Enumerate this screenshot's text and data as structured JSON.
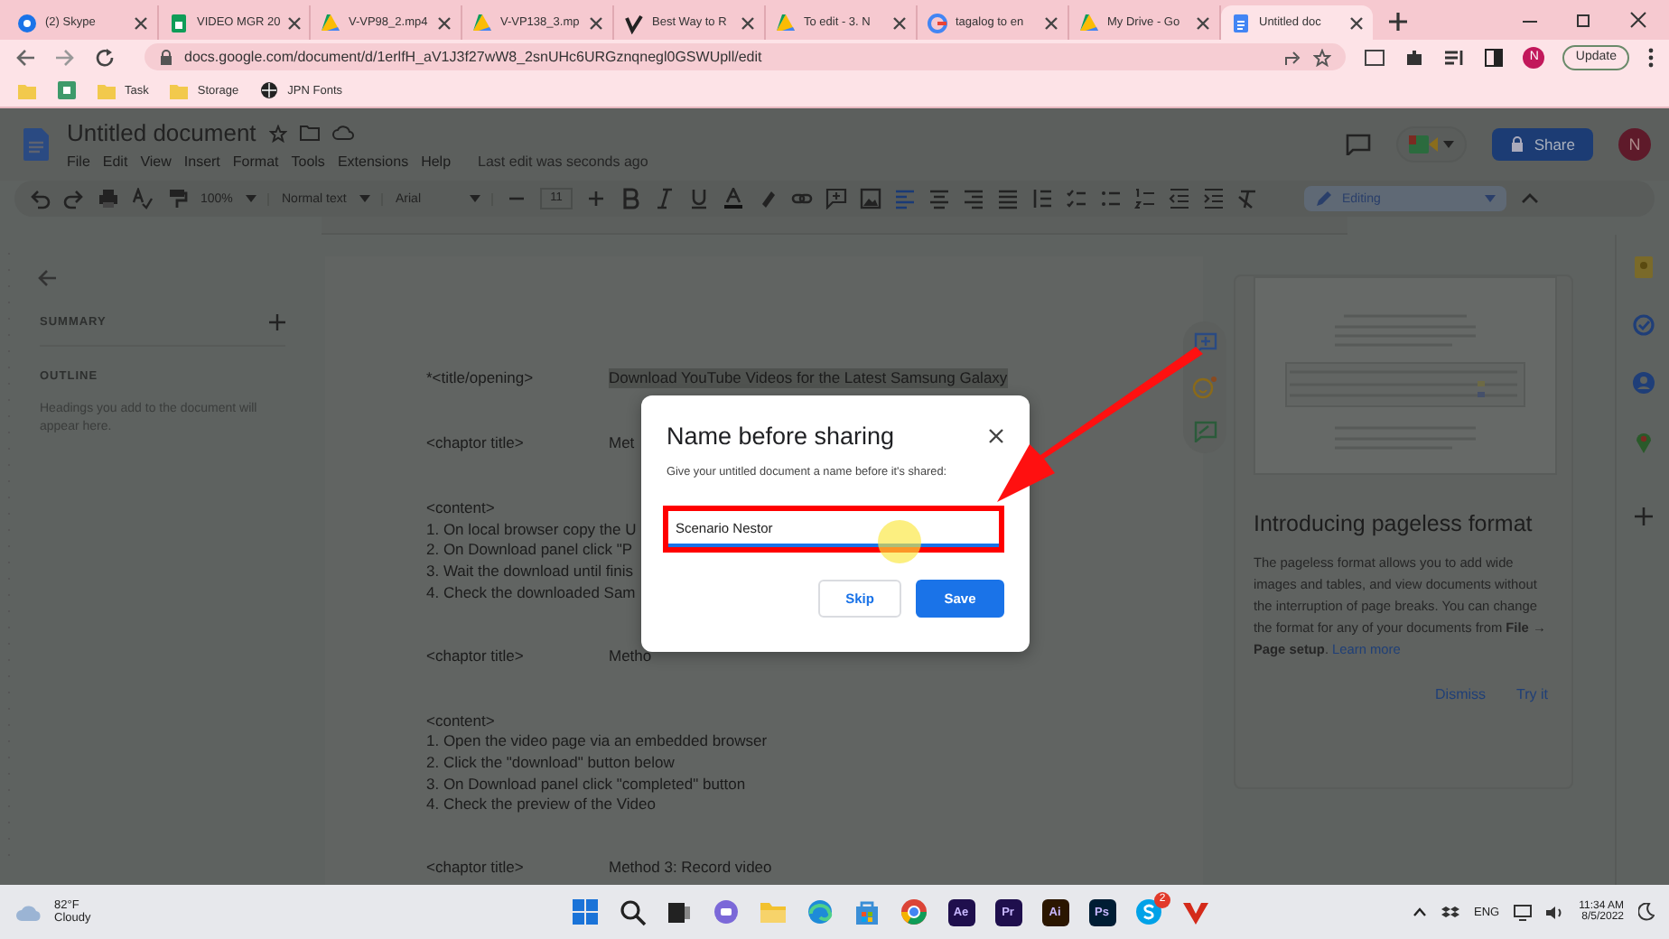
{
  "browser": {
    "tabs": [
      {
        "kind": "skype",
        "title": "(2) Skype",
        "selected": false
      },
      {
        "kind": "sheets",
        "title": "VIDEO MGR 20",
        "selected": false
      },
      {
        "kind": "drive",
        "title": "V-VP98_2.mp4",
        "selected": false
      },
      {
        "kind": "drive",
        "title": "V-VP138_3.mp",
        "selected": false
      },
      {
        "kind": "video",
        "title": "Best Way to R",
        "selected": false
      },
      {
        "kind": "drive",
        "title": "To edit - 3. N",
        "selected": false
      },
      {
        "kind": "google",
        "title": "tagalog to en",
        "selected": false
      },
      {
        "kind": "drive",
        "title": "My Drive - Go",
        "selected": false
      },
      {
        "kind": "docs",
        "title": "Untitled doc",
        "selected": true
      }
    ],
    "url": "docs.google.com/document/d/1erlfH_aV1J3f27wW8_2snUHc6URGznqnegl0GSWUpll/edit",
    "bookmarks": [
      {
        "kind": "folder",
        "label": "Task"
      },
      {
        "kind": "folder",
        "label": "Storage"
      },
      {
        "kind": "globe",
        "label": "JPN Fonts"
      }
    ],
    "profile": "N",
    "update": "Update"
  },
  "docs": {
    "title": "Untitled document",
    "menu": [
      "File",
      "Edit",
      "View",
      "Insert",
      "Format",
      "Tools",
      "Extensions",
      "Help"
    ],
    "last_edit": "Last edit was seconds ago",
    "share": "Share",
    "avatar": "N",
    "toolbar": {
      "zoom": "100%",
      "style": "Normal text",
      "font": "Arial",
      "size": "11",
      "mode": "Editing"
    }
  },
  "outline": {
    "summary": "SUMMARY",
    "outline": "OUTLINE",
    "hint": "Headings you add to the document will appear here."
  },
  "document": {
    "blocks": [
      {
        "kind": "heading",
        "label": "*<title/opening>",
        "text": "Download YouTube Videos for the Latest Samsung Galaxy",
        "highlight": true
      },
      {
        "kind": "heading",
        "label": "<chaptor title>",
        "text": "Met",
        "highlight": false
      },
      {
        "kind": "list",
        "title": "<content>",
        "items": [
          "1. On local browser copy the U",
          "2. On Download panel click \"P",
          "3. Wait the download until finis",
          "4. Check the downloaded Sam"
        ]
      },
      {
        "kind": "heading",
        "label": "<chaptor title>",
        "text": "Metho",
        "highlight": false
      },
      {
        "kind": "list",
        "title": "<content>",
        "items": [
          "1. Open the video page via an embedded browser",
          "2. Click the \"download\" button below",
          "3. On Download panel click \"completed\" button",
          "4. Check the preview of the Video"
        ]
      },
      {
        "kind": "heading",
        "label": "<chaptor title>",
        "text": "Method 3: Record video",
        "highlight": false
      }
    ]
  },
  "pageless_card": {
    "title": "Introducing pageless format",
    "body": "The pageless format allows you to add wide images and tables, and view documents without the interruption of page breaks. You can change the format for any of your documents from **File → Page setup**.",
    "link": "Learn more",
    "dismiss": "Dismiss",
    "try": "Try it"
  },
  "dialog": {
    "title": "Name before sharing",
    "subtitle": "Give your untitled document a name before it's shared:",
    "value": "Scenario Nestor",
    "skip": "Skip",
    "save": "Save"
  },
  "taskbar": {
    "temperature": "82°F",
    "weather": "Cloudy",
    "apps": [
      {
        "kind": "start"
      },
      {
        "kind": "search"
      },
      {
        "kind": "taskview"
      },
      {
        "kind": "chat"
      },
      {
        "kind": "explorer"
      },
      {
        "kind": "edge"
      },
      {
        "kind": "store"
      },
      {
        "kind": "chrome"
      },
      {
        "kind": "tile",
        "label": "Ae",
        "color": "#1f0f4d"
      },
      {
        "kind": "tile",
        "label": "Pr",
        "color": "#1f0f4d"
      },
      {
        "kind": "tile",
        "label": "Ai",
        "color": "#2b1600"
      },
      {
        "kind": "tile",
        "label": "Ps",
        "color": "#001d34"
      },
      {
        "kind": "skype",
        "badge": "2"
      },
      {
        "kind": "vegas"
      }
    ],
    "language": "ENG",
    "time": "11:34 AM",
    "date": "8/5/2022"
  }
}
